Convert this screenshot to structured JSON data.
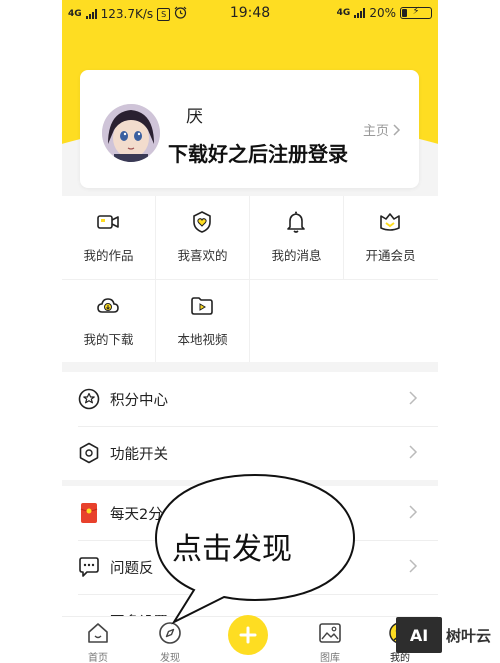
{
  "statusbar": {
    "network": "4G",
    "speed": "123.7K/s",
    "s_icon": "S",
    "time": "19:48",
    "network_right": "4G",
    "battery": "20%"
  },
  "profile": {
    "name": "厌",
    "overlay_caption": "下载好之后注册登录",
    "homepage_label": "主页"
  },
  "grid": {
    "items": [
      {
        "label": "我的作品",
        "icon": "video-camera-icon"
      },
      {
        "label": "我喜欢的",
        "icon": "heart-badge-icon"
      },
      {
        "label": "我的消息",
        "icon": "bell-icon"
      },
      {
        "label": "开通会员",
        "icon": "vip-crown-icon"
      },
      {
        "label": "我的下载",
        "icon": "cloud-download-icon"
      },
      {
        "label": "本地视频",
        "icon": "folder-play-icon"
      }
    ]
  },
  "list1": {
    "items": [
      {
        "label": "积分中心",
        "icon": "star-circle-icon"
      },
      {
        "label": "功能开关",
        "icon": "hexagon-settings-icon"
      }
    ]
  },
  "list2": {
    "items": [
      {
        "label": "每天2分",
        "icon": "red-envelope-icon"
      },
      {
        "label": "问题反",
        "icon": "feedback-icon"
      },
      {
        "label": "更多设置",
        "icon": "more-settings-icon"
      }
    ]
  },
  "tabbar": {
    "tabs": [
      {
        "label": "首页",
        "icon": "home-icon"
      },
      {
        "label": "发现",
        "icon": "compass-icon"
      },
      {
        "label": "",
        "icon": "plus-icon"
      },
      {
        "label": "图库",
        "icon": "gallery-icon"
      },
      {
        "label": "我的",
        "icon": "profile-icon"
      }
    ]
  },
  "annotation": {
    "bubble_text": "点击发现"
  },
  "watermark": {
    "box": "AI",
    "text": "树叶云"
  },
  "colors": {
    "accent": "#fedd22",
    "background": "#f4f4f4",
    "envelope": "#e8412c"
  }
}
